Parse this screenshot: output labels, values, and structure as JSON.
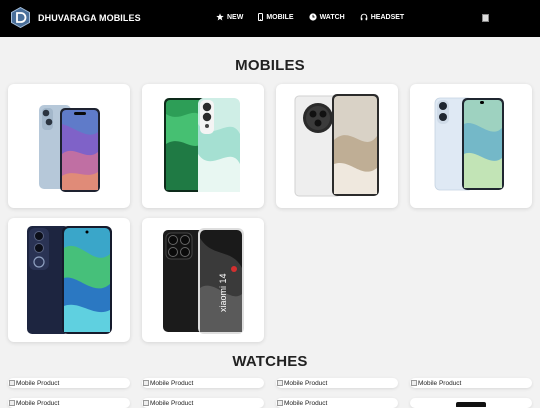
{
  "brand": {
    "name": "DHUVARAGA MOBILES"
  },
  "nav": [
    {
      "label": "NEW",
      "icon": "star-icon"
    },
    {
      "label": "MOBILE",
      "icon": "phone-icon"
    },
    {
      "label": "WATCH",
      "icon": "clock-icon"
    },
    {
      "label": "HEADSET",
      "icon": "headphones-icon"
    }
  ],
  "sections": {
    "mobiles": {
      "title": "MOBILES"
    },
    "watches": {
      "title": "WATCHES"
    }
  },
  "products": {
    "mobiles": [
      {
        "name": "iPhone 14 (blue)"
      },
      {
        "name": "Green curved phone"
      },
      {
        "name": "White camera-ring phone"
      },
      {
        "name": "Light blue phone"
      },
      {
        "name": "Navy phone"
      },
      {
        "name": "Xiaomi 14 (black)",
        "text": "xiaomi 14"
      }
    ],
    "broken_alt": "Mobile Product"
  },
  "colors": {
    "navbar": "#000000",
    "page_bg": "#f2f2f2",
    "card_bg": "#ffffff"
  }
}
